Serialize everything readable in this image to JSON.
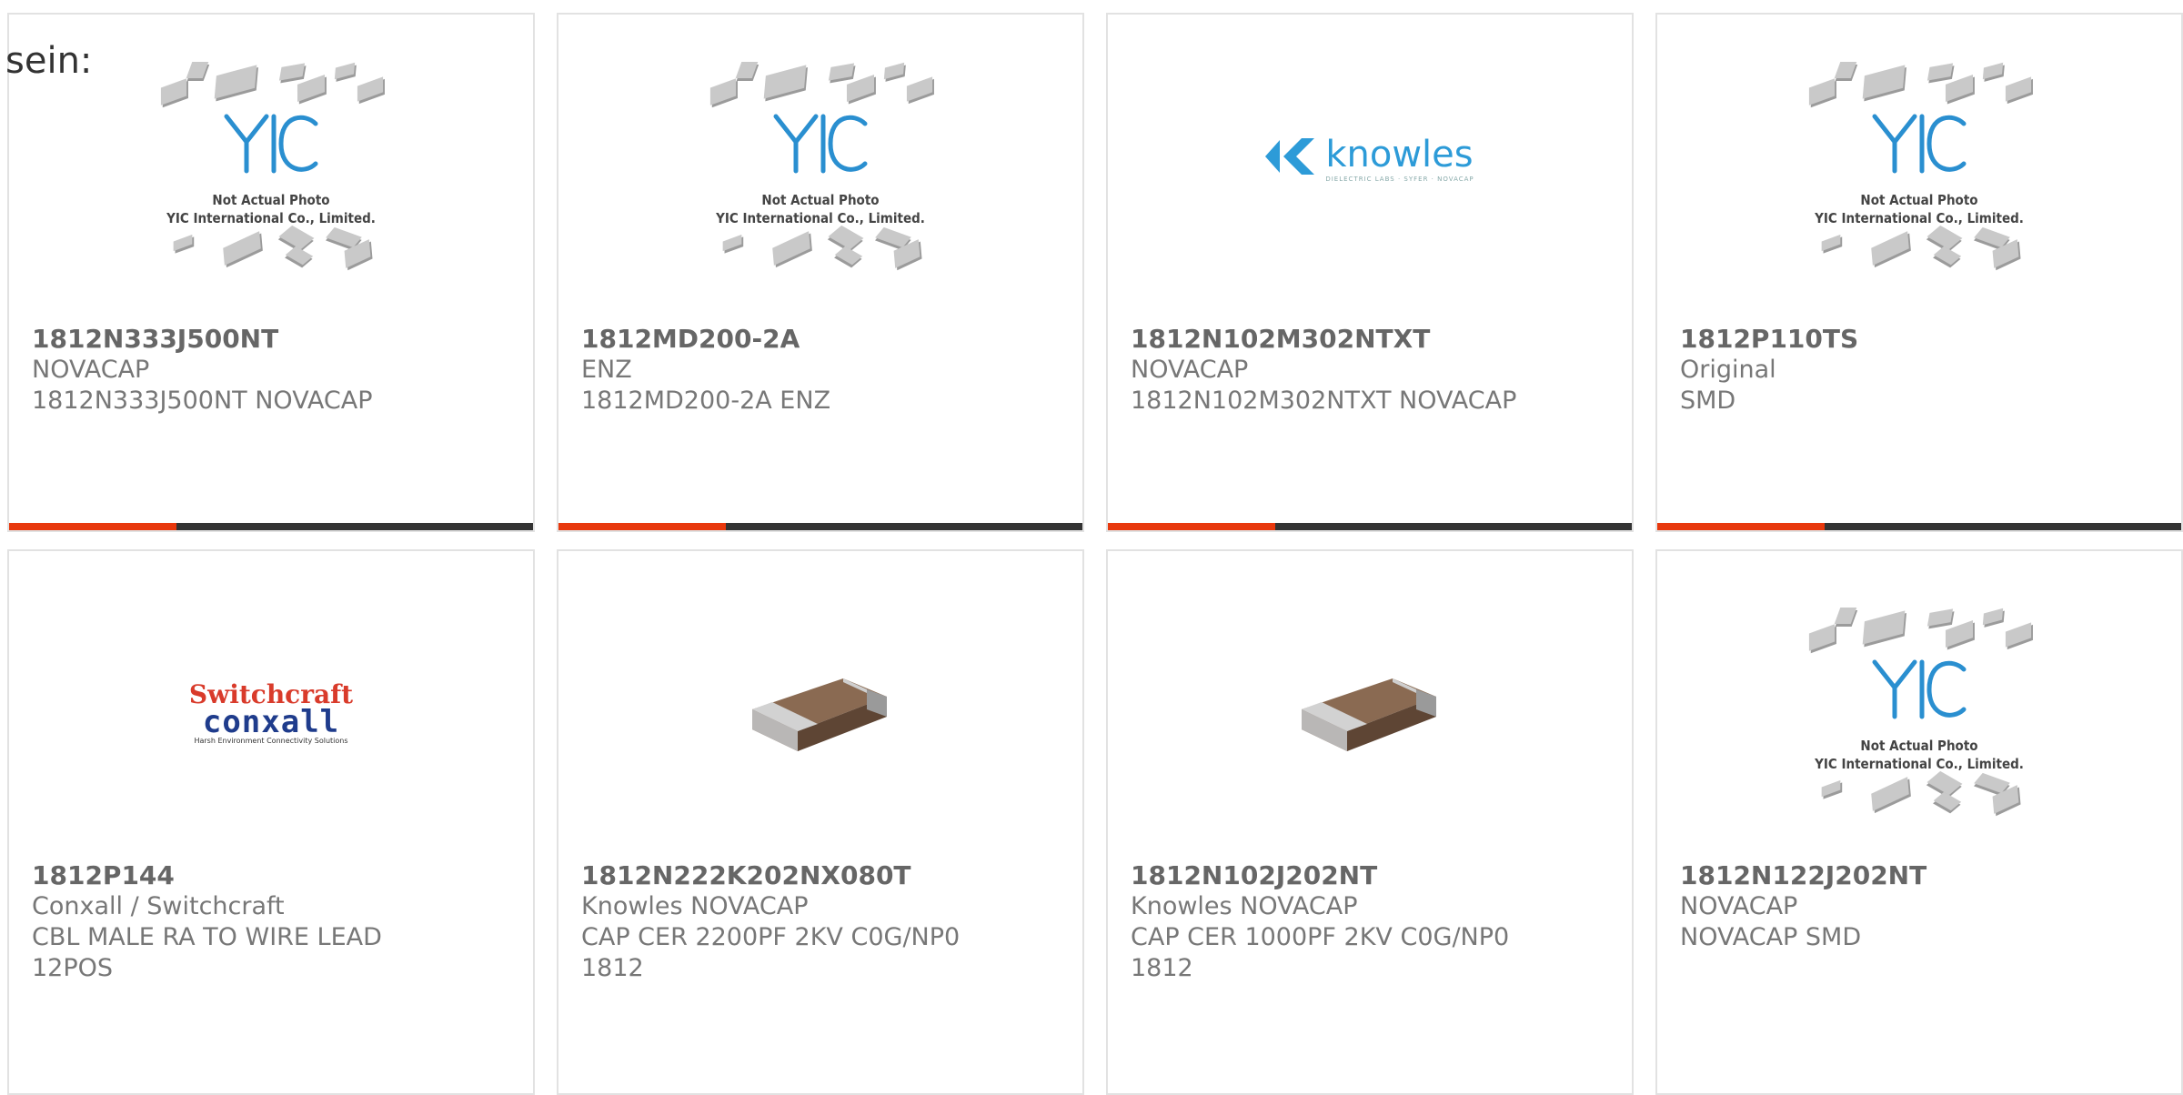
{
  "intro_text": "sein:",
  "placeholder": {
    "logo_text": "YIC",
    "caption_line1": "Not Actual Photo",
    "caption_line2": "YIC International Co., Limited."
  },
  "brands": {
    "knowles": {
      "name": "knowles",
      "tagline": "DIELECTRIC LABS · SYFER · NOVACAP"
    },
    "switchcraft": {
      "line1": "Switchcraft",
      "line2": "conxall",
      "tagline": "Harsh Environment Connectivity Solutions"
    }
  },
  "colors": {
    "accent": "#e8380d",
    "bar_track": "#333333",
    "capacitor_body": "#7a5a44",
    "capacitor_terminal": "#b8b8b8"
  },
  "products": [
    {
      "part_number": "1812N333J500NT",
      "manufacturer": "NOVACAP",
      "desc1": "1812N333J500NT NOVACAP",
      "desc2": "",
      "image": "yic-placeholder",
      "progress": 0.32
    },
    {
      "part_number": "1812MD200-2A",
      "manufacturer": "ENZ",
      "desc1": "1812MD200-2A ENZ",
      "desc2": "",
      "image": "yic-placeholder",
      "progress": 0.32
    },
    {
      "part_number": "1812N102M302NTXT",
      "manufacturer": "NOVACAP",
      "desc1": "1812N102M302NTXT NOVACAP",
      "desc2": "",
      "image": "knowles-logo",
      "progress": 0.32
    },
    {
      "part_number": "1812P110TS",
      "manufacturer": "Original",
      "desc1": "SMD",
      "desc2": "",
      "image": "yic-placeholder",
      "progress": 0.32
    },
    {
      "part_number": "1812P144",
      "manufacturer": "Conxall / Switchcraft",
      "desc1": "CBL MALE RA TO WIRE LEAD",
      "desc2": "12POS",
      "image": "switchcraft-logo"
    },
    {
      "part_number": "1812N222K202NX080T",
      "manufacturer": "Knowles NOVACAP",
      "desc1": "CAP CER 2200PF 2KV C0G/NP0",
      "desc2": "1812",
      "image": "capacitor-photo"
    },
    {
      "part_number": "1812N102J202NT",
      "manufacturer": "Knowles NOVACAP",
      "desc1": "CAP CER 1000PF 2KV C0G/NP0",
      "desc2": "1812",
      "image": "capacitor-photo"
    },
    {
      "part_number": "1812N122J202NT",
      "manufacturer": "NOVACAP",
      "desc1": "NOVACAP SMD",
      "desc2": "",
      "image": "yic-placeholder"
    }
  ]
}
